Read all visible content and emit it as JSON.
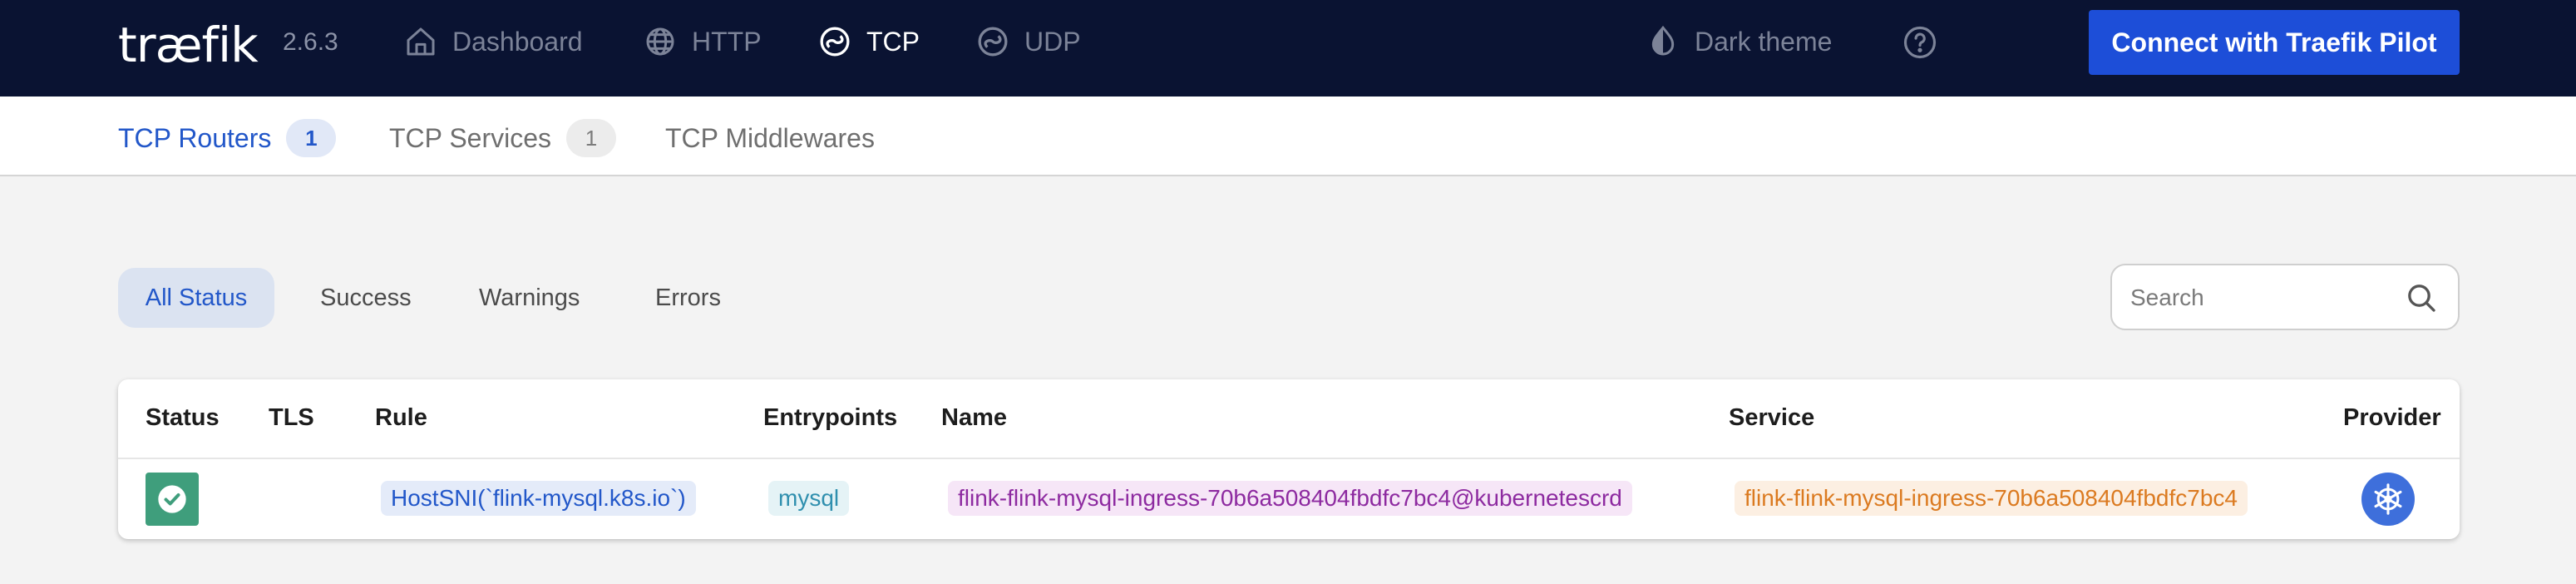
{
  "app": {
    "logo": "træfik",
    "version": "2.6.3"
  },
  "nav": {
    "items": [
      {
        "label": "Dashboard",
        "icon": "home-icon",
        "active": false
      },
      {
        "label": "HTTP",
        "icon": "globe-icon",
        "active": false
      },
      {
        "label": "TCP",
        "icon": "tcp-icon",
        "active": true
      },
      {
        "label": "UDP",
        "icon": "udp-icon",
        "active": false
      }
    ],
    "theme_label": "Dark theme",
    "pilot_button": "Connect with Traefik Pilot"
  },
  "subtabs": [
    {
      "label": "TCP Routers",
      "count": "1",
      "active": true
    },
    {
      "label": "TCP Services",
      "count": "1",
      "active": false
    },
    {
      "label": "TCP Middlewares",
      "active": false
    }
  ],
  "filters": {
    "all": "All Status",
    "success": "Success",
    "warnings": "Warnings",
    "errors": "Errors",
    "selected": "All Status"
  },
  "search": {
    "placeholder": "Search",
    "value": ""
  },
  "table": {
    "headers": {
      "status": "Status",
      "tls": "TLS",
      "rule": "Rule",
      "entrypoints": "Entrypoints",
      "name": "Name",
      "service": "Service",
      "provider": "Provider"
    },
    "rows": [
      {
        "status": "success",
        "tls": "",
        "rule": "HostSNI(`flink-mysql.k8s.io`)",
        "entrypoints": "mysql",
        "name": "flink-flink-mysql-ingress-70b6a508404fbdfc7bc4@kubernetescrd",
        "service": "flink-flink-mysql-ingress-70b6a508404fbdfc7bc4",
        "provider": "kubernetes-icon"
      }
    ]
  },
  "colors": {
    "topbar": "#0a1332",
    "accent": "#1d4ed8",
    "success": "#3f9e7c"
  }
}
